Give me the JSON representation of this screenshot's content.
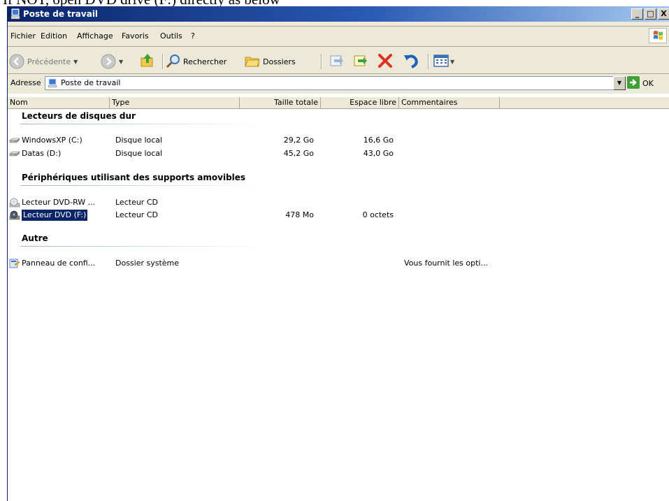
{
  "doc_text": "If NOT, open DVD drive (F:) directly as below",
  "window": {
    "title": "Poste de travail",
    "buttons": [
      "_",
      "□",
      "X"
    ]
  },
  "menu": [
    {
      "label": "Fichier"
    },
    {
      "label": "Edition"
    },
    {
      "label": "Affichage"
    },
    {
      "label": "Favoris"
    },
    {
      "label": "Outils"
    },
    {
      "label": "?"
    }
  ],
  "toolbar": {
    "back_label": "Précédente",
    "search_label": "Rechercher",
    "folders_label": "Dossiers"
  },
  "address": {
    "label": "Adresse",
    "value": "Poste de travail",
    "go_label": "OK"
  },
  "columns": [
    "Nom",
    "Type",
    "Taille totale",
    "Espace libre",
    "Commentaires"
  ],
  "groups": [
    {
      "title": "Lecteurs de disques dur",
      "items": [
        {
          "name": "WindowsXP (C:)",
          "type": "Disque local",
          "total": "29,2 Go",
          "free": "16,6 Go",
          "comment": "",
          "icon": "hard-drive-icon"
        },
        {
          "name": "Datas (D:)",
          "type": "Disque local",
          "total": "45,2 Go",
          "free": "43,0 Go",
          "comment": "",
          "icon": "hard-drive-icon"
        }
      ]
    },
    {
      "title": "Périphériques utilisant des supports amovibles",
      "items": [
        {
          "name": "Lecteur DVD-RW ...",
          "type": "Lecteur CD",
          "total": "",
          "free": "",
          "comment": "",
          "icon": "cd-drive-icon"
        },
        {
          "name": "Lecteur DVD (F:)",
          "type": "Lecteur CD",
          "total": "478 Mo",
          "free": "0 octets",
          "comment": "",
          "icon": "dvd-drive-icon",
          "selected": true
        }
      ]
    },
    {
      "title": "Autre",
      "items": [
        {
          "name": "Panneau de confi...",
          "type": "Dossier système",
          "total": "",
          "free": "",
          "comment": "Vous fournit les opti...",
          "icon": "control-panel-icon"
        }
      ]
    }
  ],
  "colors": {
    "title_start": "#0a246a",
    "title_end": "#a6caf0",
    "selection": "#0a246a",
    "chrome": "#ece9d8"
  }
}
